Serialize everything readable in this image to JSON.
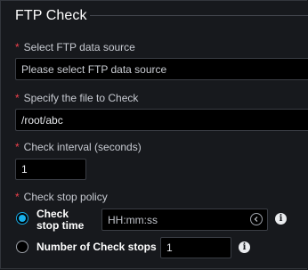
{
  "section": {
    "title": "FTP Check"
  },
  "fields": {
    "required_mark": "*",
    "data_source": {
      "label": "Select FTP data source",
      "placeholder": "Please select FTP data source"
    },
    "file_to_check": {
      "label": "Specify the file to Check",
      "value": "/root/abc"
    },
    "check_interval": {
      "label": "Check interval (seconds)",
      "value": "1"
    },
    "stop_policy": {
      "label": "Check stop policy",
      "options": [
        {
          "label_line1": "Check",
          "label_line2": "stop time",
          "selected": true,
          "placeholder": "HH:mm:ss",
          "icon": "chevron-left-circle-icon"
        },
        {
          "label": "Number of Check stops",
          "selected": false,
          "value": "1"
        }
      ],
      "info_icon": "info-icon"
    }
  },
  "colors": {
    "background": "#17191d",
    "required": "#f0414d",
    "accent": "#19b0ea",
    "input_bg": "#000000"
  }
}
